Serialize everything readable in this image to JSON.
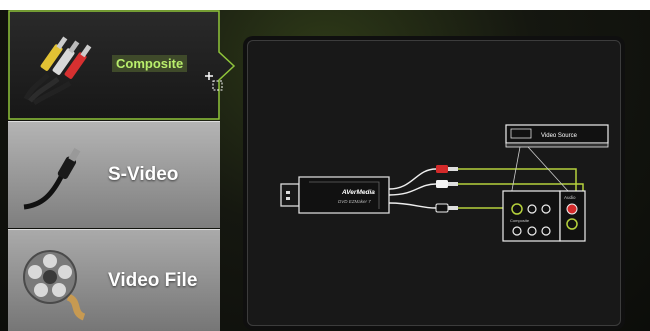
{
  "sources": [
    {
      "id": "composite",
      "label": "Composite",
      "icon": "rca-plugs-icon",
      "selected": true
    },
    {
      "id": "svideo",
      "label": "S-Video",
      "icon": "s-video-cable-icon",
      "selected": false
    },
    {
      "id": "videofile",
      "label": "Video File",
      "icon": "film-reel-icon",
      "selected": false
    }
  ],
  "diagram": {
    "device_brand": "AVerMedia",
    "device_model": "DVD EZMaker 7",
    "video_source_label": "Video Source",
    "composite_label": "Composite",
    "audio_label": "Audio"
  },
  "colors": {
    "selected_text": "#b9ee6c",
    "accent": "#8fc43a",
    "cable_green": "#b5d13c",
    "plug_red": "#d42a2a"
  }
}
